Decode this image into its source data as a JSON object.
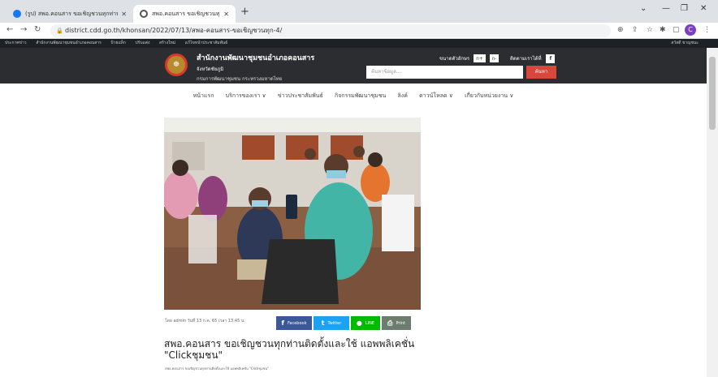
{
  "browser": {
    "tabs": [
      {
        "title": "(รูป) สพอ.คอนสาร ขอเชิญชวนทุกท่าน",
        "favicon": "facebook-icon"
      },
      {
        "title": "สพอ.คอนสาร ขอเชิญชวนทุกท่านติดตั้ง",
        "favicon": "site-icon"
      }
    ],
    "url": "district.cdd.go.th/khonsan/2022/07/13/สพอ-คอนสาร-ขอเชิญชวนทุก-4/",
    "profile_initial": "C"
  },
  "bookmarks": [
    "ประกาศข่าว",
    "สำนักงานพัฒนาชุมชนอำเภอคอนสาร",
    "ป้ายแท็ก",
    "ปรับแต่ง",
    "สร้างใหม่",
    "แก้ไขหน้าประชาสัมพันธ์"
  ],
  "bookmarks_right": "สวัสดี ชาญชนะ",
  "site": {
    "org_name": "สำนักงานพัฒนาชุมชนอำเภอคอนสาร",
    "province": "จังหวัดชัยภูมิ",
    "department": "กรมการพัฒนาชุมชน กระทรวงมหาดไทย",
    "font_size_label": "ขนาดตัวอักษร",
    "font_size_buttons": [
      "ก+",
      "ก-"
    ],
    "contact_label": "ติดตามเราได้ที่",
    "facebook_glyph": "f",
    "search_placeholder": "ค้นหาข้อมูล...",
    "search_button": "ค้นหา"
  },
  "nav": [
    "หน้าแรก",
    "บริการของเรา ∨",
    "ข่าวประชาสัมพันธ์",
    "กิจกรรมพัฒนาชุมชน",
    "ลิงค์",
    "ดาวน์โหลด ∨",
    "เกี่ยวกับหน่วยงาน ∨"
  ],
  "article": {
    "meta": "โดย admin วันที่ 13 ก.ค. 65 เวลา 13:45 น.",
    "share": [
      {
        "label": "Facebook",
        "glyph": "f",
        "color": "#3b5998"
      },
      {
        "label": "Twitter",
        "glyph": "t",
        "color": "#1da1f2"
      },
      {
        "label": "LINE",
        "glyph": "●",
        "color": "#00b900"
      },
      {
        "label": "Print",
        "glyph": "⎙",
        "color": "#6d7d6d"
      }
    ],
    "headline": "สพอ.คอนสาร ขอเชิญชวนทุกท่านติดตั้งและใช้ แอพพลิเคชั่น \"Clickชุมชน\"",
    "excerpt": "สพอ.คอนสาร ขอเชิญชวนทุกท่านติดตั้งและใช้ แอพพลิเคชั่น \"Clickชุมชน\""
  }
}
